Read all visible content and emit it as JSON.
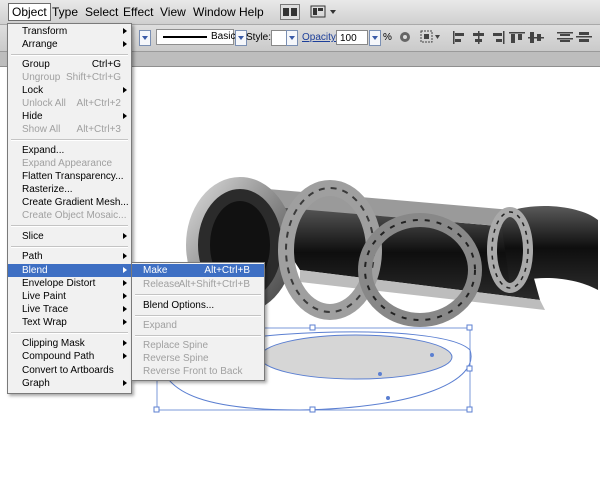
{
  "menubar": {
    "items": [
      "Object",
      "Type",
      "Select",
      "Effect",
      "View",
      "Window",
      "Help"
    ]
  },
  "optionsbar": {
    "stroke_profile": "Basic",
    "style_label": "Style:",
    "opacity_label": "Opacity:",
    "opacity_value": "100",
    "percent": "%"
  },
  "object_menu": {
    "items": [
      {
        "label": "Transform",
        "submenu": true
      },
      {
        "label": "Arrange",
        "submenu": true
      },
      {
        "label": "Group",
        "shortcut": "Ctrl+G"
      },
      {
        "label": "Ungroup",
        "shortcut": "Shift+Ctrl+G",
        "disabled": true
      },
      {
        "label": "Lock",
        "submenu": true
      },
      {
        "label": "Unlock All",
        "shortcut": "Alt+Ctrl+2",
        "disabled": true
      },
      {
        "label": "Hide",
        "submenu": true
      },
      {
        "label": "Show All",
        "shortcut": "Alt+Ctrl+3",
        "disabled": true
      },
      {
        "label": "Expand..."
      },
      {
        "label": "Expand Appearance",
        "disabled": true
      },
      {
        "label": "Flatten Transparency..."
      },
      {
        "label": "Rasterize..."
      },
      {
        "label": "Create Gradient Mesh..."
      },
      {
        "label": "Create Object Mosaic...",
        "disabled": true
      },
      {
        "label": "Slice",
        "submenu": true
      },
      {
        "label": "Path",
        "submenu": true
      },
      {
        "label": "Blend",
        "submenu": true,
        "highlighted": true
      },
      {
        "label": "Envelope Distort",
        "submenu": true
      },
      {
        "label": "Live Paint",
        "submenu": true
      },
      {
        "label": "Live Trace",
        "submenu": true
      },
      {
        "label": "Text Wrap",
        "submenu": true
      },
      {
        "label": "Clipping Mask",
        "submenu": true
      },
      {
        "label": "Compound Path",
        "submenu": true
      },
      {
        "label": "Convert to Artboards"
      },
      {
        "label": "Graph",
        "submenu": true
      }
    ]
  },
  "blend_submenu": {
    "items": [
      {
        "label": "Make",
        "shortcut": "Alt+Ctrl+B",
        "highlighted": true
      },
      {
        "label": "Release",
        "shortcut": "Alt+Shift+Ctrl+B",
        "disabled": true
      },
      {
        "label": "Blend Options..."
      },
      {
        "label": "Expand",
        "disabled": true
      },
      {
        "label": "Replace Spine",
        "disabled": true
      },
      {
        "label": "Reverse Spine",
        "disabled": true
      },
      {
        "label": "Reverse Front to Back",
        "disabled": true
      }
    ]
  },
  "icons": {
    "bridge": "br-icon",
    "workspace": "workspace-icon"
  }
}
